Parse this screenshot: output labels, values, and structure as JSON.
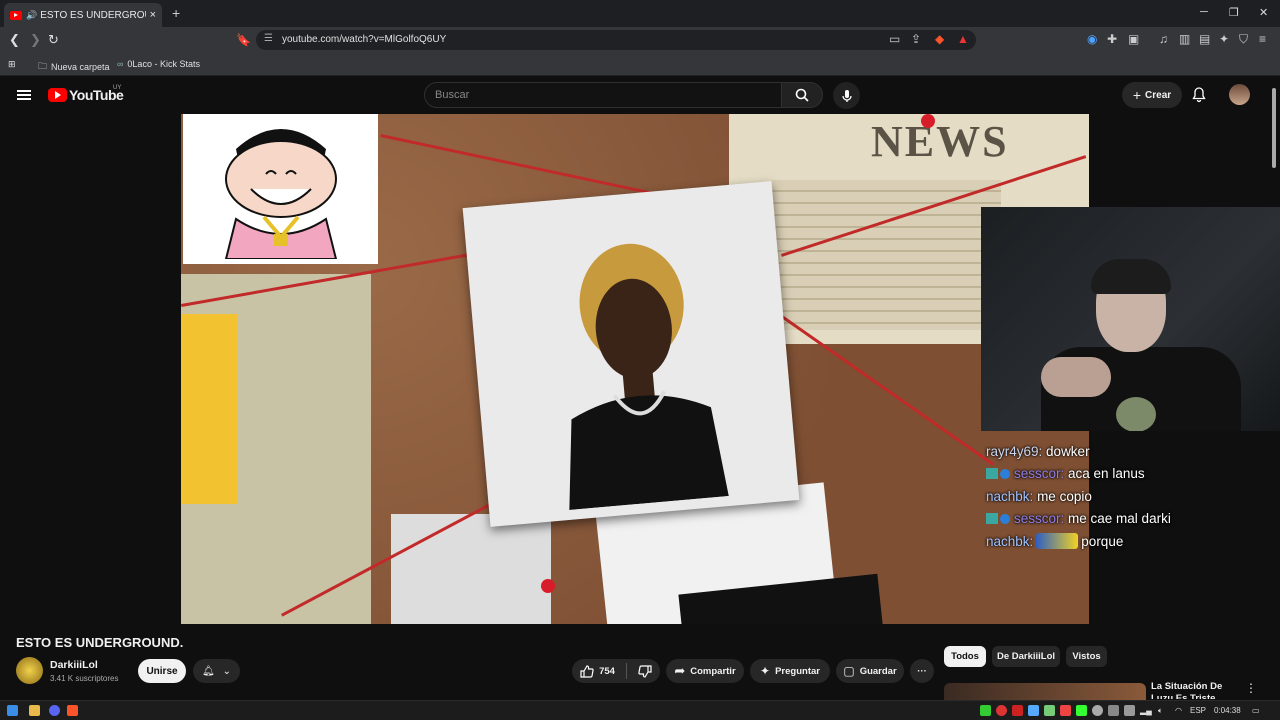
{
  "browser": {
    "tab_title": "ESTO ES UNDERGROUND. - Y",
    "tab_close": "×",
    "new_tab": "+",
    "url": "youtube.com/watch?v=MlGolfoQ6UY",
    "bookmarks": [
      {
        "label": "Nueva carpeta"
      },
      {
        "label": "0Laco - Kick Stats"
      }
    ]
  },
  "youtube": {
    "logo_text": "YouTube",
    "country_code": "UY",
    "search_placeholder": "Buscar",
    "create_label": "Crear"
  },
  "video": {
    "overlay_text": "NEWS",
    "chat": [
      {
        "user": "rayr4y69:",
        "message": "dowker"
      },
      {
        "user": "sesscor:",
        "message": "aca en lanus"
      },
      {
        "user": "nachbk:",
        "message": "me copio"
      },
      {
        "user": "sesscor:",
        "message": "me cae mal darki"
      },
      {
        "user": "nachbk:",
        "message": "porque"
      }
    ]
  },
  "watch": {
    "title": "ESTO ES UNDERGROUND.",
    "channel_name": "DarkiiiLol",
    "subscribers": "3.41 K suscriptores",
    "join_label": "Unirse",
    "likes": "754",
    "share_label": "Compartir",
    "ask_label": "Preguntar",
    "save_label": "Guardar",
    "more_label": "···"
  },
  "related": {
    "chips": [
      "Todos",
      "De DarkiiiLol",
      "Vistos"
    ],
    "first_title": "La Situación De Luzu Es Triste"
  },
  "taskbar": {
    "language": "ESP",
    "time": "0:04:38"
  },
  "colors": {
    "youtube_red": "#ff0000",
    "bg": "#0f0f0f",
    "pill": "#272727"
  }
}
